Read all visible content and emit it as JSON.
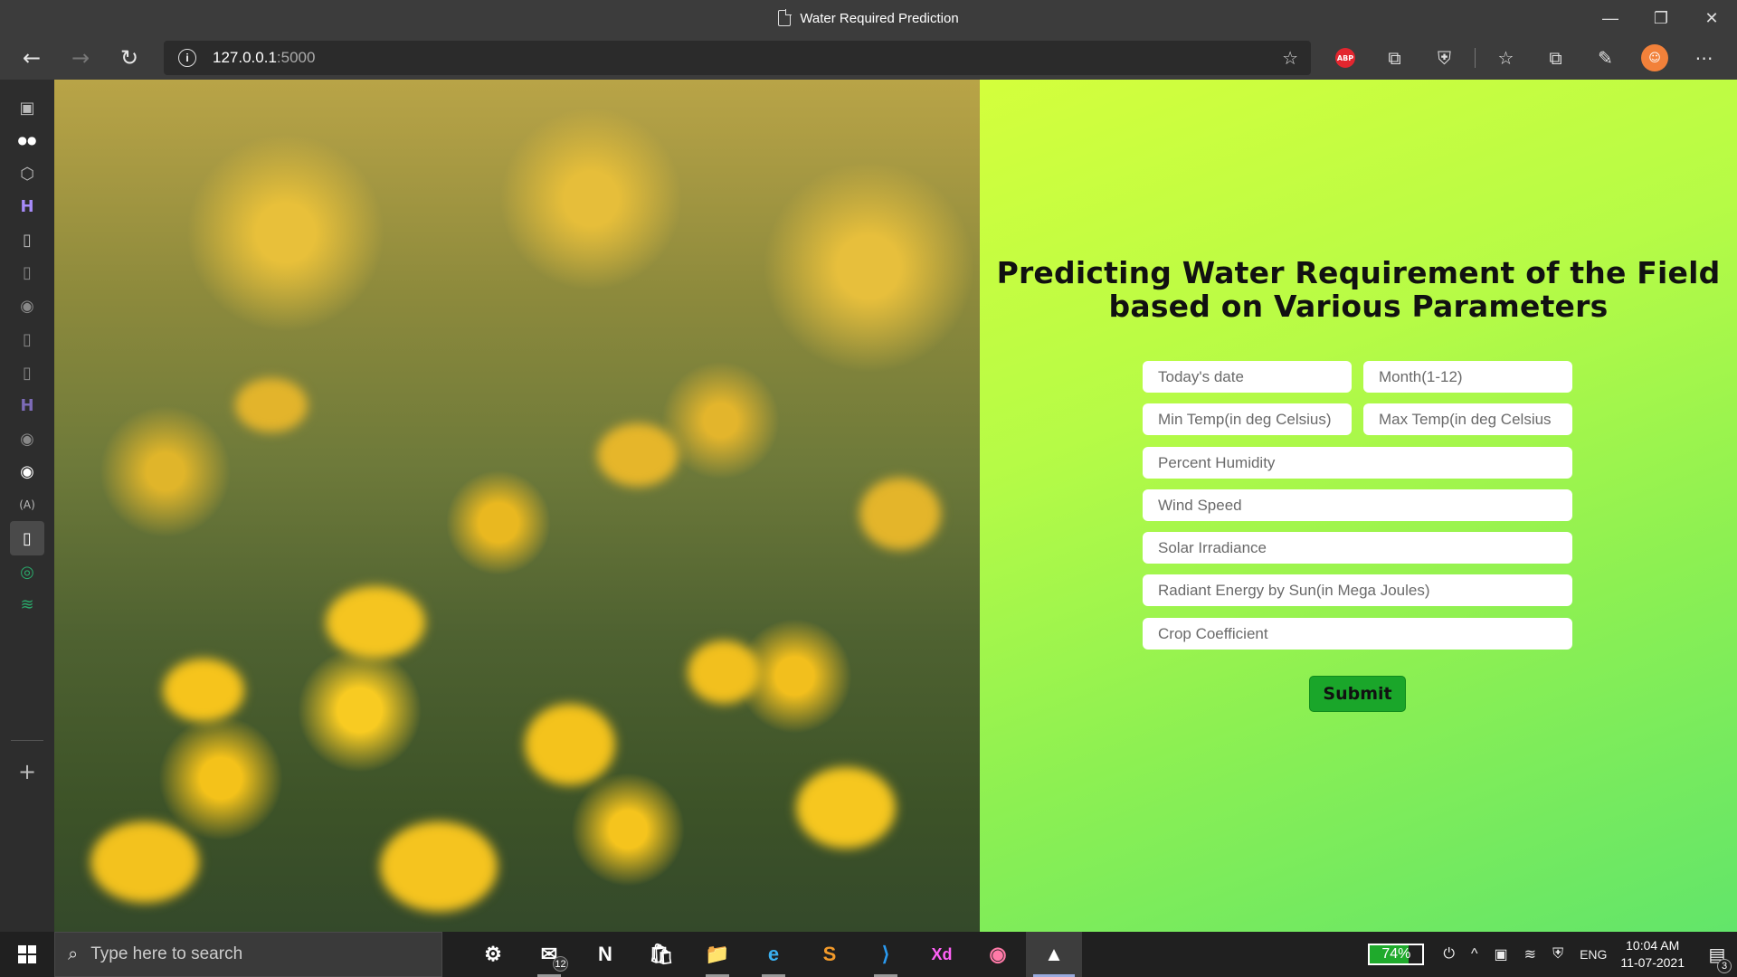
{
  "window": {
    "title": "Water Required Prediction",
    "controls": [
      "—",
      "❐",
      "✕"
    ]
  },
  "toolbar": {
    "back_icon": "←",
    "forward_icon": "→",
    "reload_icon": "↻",
    "url_host": "127.0.0.1",
    "url_port": ":5000",
    "info_icon": "i",
    "favorite_icon": "☆",
    "abp_label": "ABP",
    "extension_icons": [
      "⧉",
      "⛨"
    ],
    "favorites_icon": "☆",
    "collections_icon": "⧉",
    "feedback_icon": "✎",
    "avatar_glyph": "☺",
    "menu_icon": "⋯"
  },
  "sidebar": {
    "items": [
      "▣",
      "●●",
      "⬡",
      "H",
      "▯",
      "▯",
      "◉",
      "▯",
      "▯",
      "H",
      "◉",
      "◉",
      "(A)",
      "▯",
      "◎",
      "≋"
    ],
    "add_icon": "+"
  },
  "page": {
    "heading_line1": "Predicting Water Requirement of the Field",
    "heading_line2": "based on Various Parameters",
    "fields": {
      "date": "Today's date",
      "month": "Month(1-12)",
      "min_temp": "Min Temp(in deg Celsius)",
      "max_temp": "Max Temp(in deg Celsius",
      "humidity": "Percent Humidity",
      "wind": "Wind Speed",
      "solar": "Solar Irradiance",
      "radiant": "Radiant Energy by Sun(in Mega Joules)",
      "crop": "Crop Coefficient"
    },
    "submit_label": "Submit",
    "colors": {
      "panel_start": "#d4ff3c",
      "panel_end": "#62e56a",
      "submit_bg": "#1aa62a"
    }
  },
  "taskbar": {
    "search_placeholder": "Type here to search",
    "search_icon": "⌕",
    "apps": [
      "⚙",
      "✉",
      "N",
      "🛍",
      "📁",
      "e",
      "S",
      "⟩",
      "Xd",
      "◉",
      "▲"
    ],
    "mail_badge": "12",
    "battery": "74%",
    "battery_level": 0.74,
    "tray_icons": [
      "⏻",
      "^",
      "▣",
      "≋",
      "⛨"
    ],
    "language": "ENG",
    "time": "10:04 AM",
    "date": "11-07-2021",
    "notif_icon": "▤",
    "notif_count": "3"
  }
}
